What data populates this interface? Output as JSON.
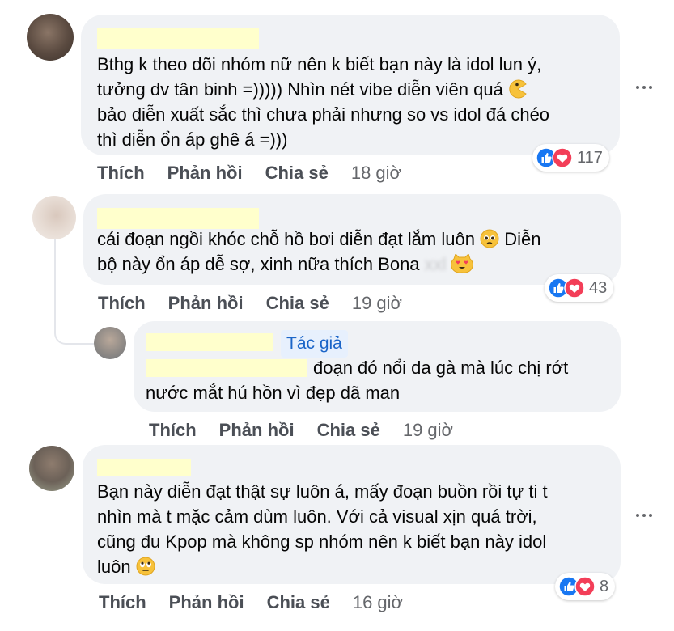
{
  "actions": {
    "like": "Thích",
    "reply": "Phản hồi",
    "share": "Chia sẻ"
  },
  "comments": [
    {
      "lines": [
        "Bthg k theo dõi nhóm nữ nên k biết bạn này là idol lun ý,",
        "tưởng dv tân binh =))))) Nhìn nét vibe diễn viên quá",
        "bảo diễn xuất sắc thì chưa phải nhưng so vs idol đá chéo",
        "thì diễn ổn áp ghê á =)))"
      ],
      "reactions": "117",
      "time": "18 giờ"
    },
    {
      "lines": [
        "cái đoạn ngồi khóc chỗ hồ bơi diễn đạt lắm luôn",
        "bộ này ổn áp dễ sợ, xinh nữa thích Bona"
      ],
      "line1_tail": "Diễn",
      "blurred": "xxl",
      "reactions": "43",
      "time": "19 giờ"
    },
    {
      "badge": "Tác giả",
      "lines": [
        "đoạn đó nổi da gà mà lúc chị rớt",
        "nước mắt hú hồn vì đẹp dã man"
      ],
      "time": "19 giờ"
    },
    {
      "lines": [
        "Bạn này diễn đạt thật sự luôn á, mấy đoạn buồn rồi tự ti t",
        "nhìn mà t mặc cảm dùm luôn. Với cả visual xịn quá trời,",
        "cũng đu Kpop mà không sp nhóm nên k biết bạn này idol",
        "luôn"
      ],
      "reactions": "8",
      "time": "16 giờ"
    }
  ],
  "colors": {
    "bubble": "#f0f2f5",
    "name_highlight": "#ffffcc",
    "like_blue": "#1877f2",
    "love_red": "#f33e58",
    "badge_bg": "#e7f0fd",
    "badge_text": "#1b65c8"
  }
}
